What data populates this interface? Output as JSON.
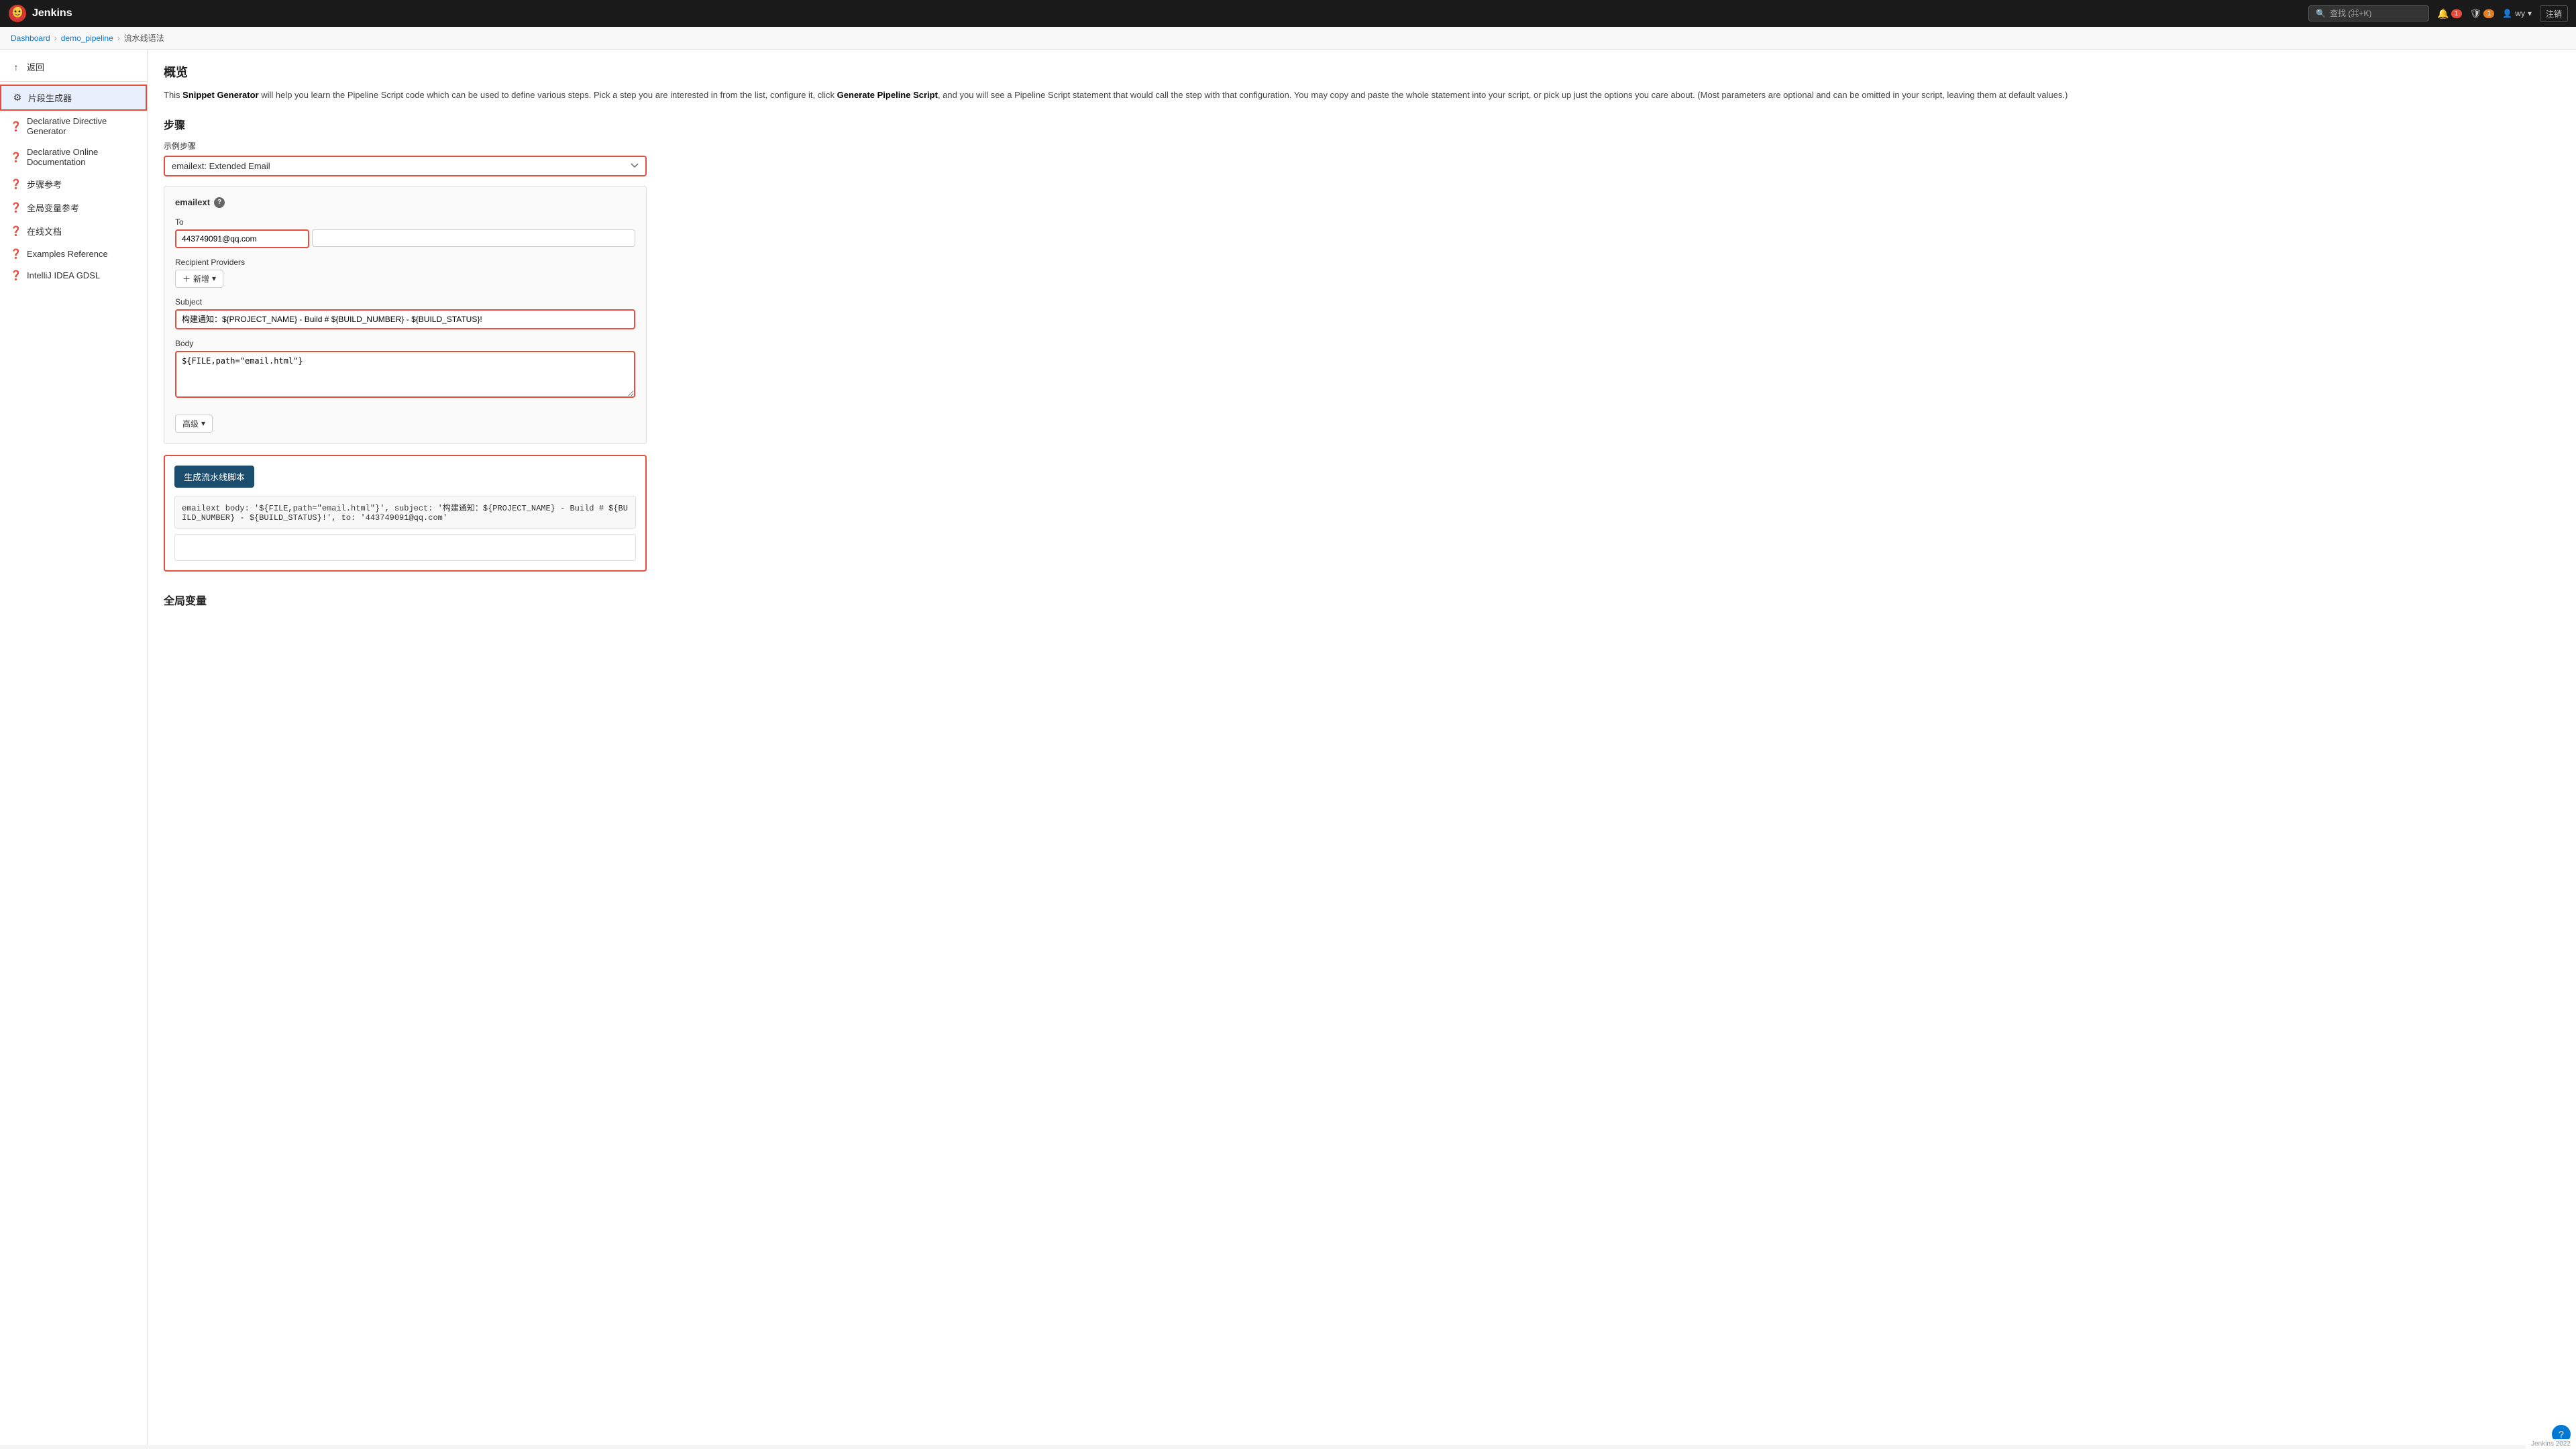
{
  "navbar": {
    "logo_alt": "Jenkins",
    "title": "Jenkins",
    "search_placeholder": "查找 (⌘+K)",
    "notifications_count": "1",
    "security_count": "1",
    "user": "wy",
    "logout_label": "注销"
  },
  "breadcrumb": {
    "items": [
      "Dashboard",
      "demo_pipeline",
      "流水线语法"
    ]
  },
  "sidebar": {
    "back_label": "返回",
    "items": [
      {
        "id": "snippet-generator",
        "icon": "⚙",
        "label": "片段生成器",
        "active": true
      },
      {
        "id": "declarative-directive",
        "icon": "?",
        "label": "Declarative Directive Generator",
        "active": false
      },
      {
        "id": "declarative-online-doc",
        "icon": "?",
        "label": "Declarative Online Documentation",
        "active": false
      },
      {
        "id": "steps-reference",
        "icon": "?",
        "label": "步骤参考",
        "active": false
      },
      {
        "id": "global-vars-reference",
        "icon": "?",
        "label": "全局变量参考",
        "active": false
      },
      {
        "id": "online-docs",
        "icon": "?",
        "label": "在线文档",
        "active": false
      },
      {
        "id": "examples-reference",
        "icon": "?",
        "label": "Examples Reference",
        "active": false
      },
      {
        "id": "intellij-idea-dsl",
        "icon": "?",
        "label": "IntelliJ IDEA GDSL",
        "active": false
      }
    ]
  },
  "main": {
    "overview_title": "概览",
    "description_text_1": "This ",
    "description_bold_1": "Snippet Generator",
    "description_text_2": " will help you learn the Pipeline Script code which can be used to define various steps. Pick a step you are interested in from the list, configure it, click ",
    "description_bold_2": "Generate Pipeline Script",
    "description_text_3": ", and you will see a Pipeline Script statement that would call the step with that configuration. You may copy and paste the whole statement into your script, or pick up just the options you care about. (Most parameters are optional and can be omitted in your script, leaving them at default values.)",
    "steps_title": "步骤",
    "sample_step_label": "示例步骤",
    "step_select_value": "emailext: Extended Email",
    "step_options": [
      "emailext: Extended Email"
    ],
    "emailext": {
      "title": "emailext",
      "to_label": "To",
      "to_value": "443749091@qq.com",
      "recipient_providers_label": "Recipient Providers",
      "add_btn_label": "新增",
      "subject_label": "Subject",
      "subject_value": "构建通知：${PROJECT_NAME} - Build # ${BUILD_NUMBER} - ${BUILD_STATUS}!",
      "body_label": "Body",
      "body_value": "${FILE,path=\"email.html\"}",
      "advanced_label": "高级"
    },
    "generate_btn_label": "生成流水线脚本",
    "generated_code": "emailext body: '${FILE,path=\"email.html\"}', subject: '构建通知：${PROJECT_NAME} - Build # ${BUILD_NUMBER} - ${BUILD_STATUS}!', to: '443749091@qq.com'",
    "global_vars_title": "全局变量"
  },
  "bottom_bar_text": "Jenkins 2022"
}
